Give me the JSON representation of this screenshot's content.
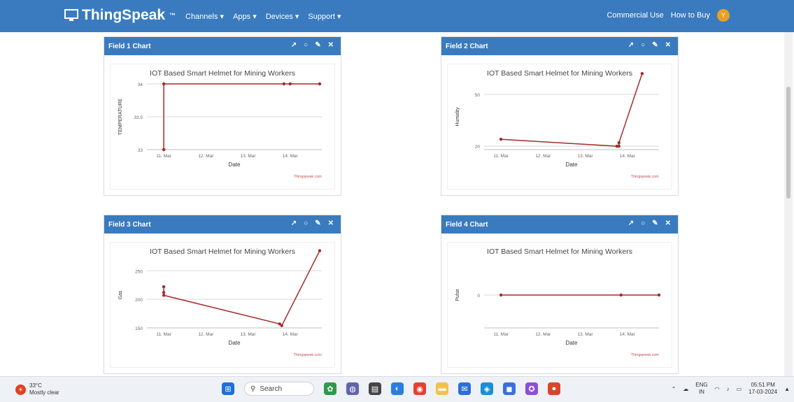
{
  "app": {
    "brand": "ThingSpeak",
    "brand_tm": "™",
    "nav": [
      "Channels ▾",
      "Apps ▾",
      "Devices ▾",
      "Support ▾"
    ],
    "right_nav": [
      "Commercial Use",
      "How to Buy"
    ],
    "avatar_initial": "Y"
  },
  "panels": [
    {
      "header": "Field 1 Chart"
    },
    {
      "header": "Field 2 Chart"
    },
    {
      "header": "Field 3 Chart"
    },
    {
      "header": "Field 4 Chart"
    }
  ],
  "panel_tools": [
    "↗",
    "○",
    "✎",
    "✕"
  ],
  "chart_data": [
    {
      "type": "line",
      "title": "IOT Based Smart Helmet for Mining Workers",
      "xlabel": "Date",
      "ylabel": "TEMPERATURE",
      "x_ticks": [
        "11. Mar",
        "12. Mar",
        "13. Mar",
        "14. Mar"
      ],
      "y_ticks": [
        "33",
        "33.5",
        "34"
      ],
      "ylim": [
        33,
        34
      ],
      "credit": "Thingspeak.com",
      "series": [
        {
          "x": [
            0.0,
            0.0,
            0.0,
            2.85,
            3.0,
            3.7
          ],
          "y": [
            33,
            33,
            34,
            34,
            34,
            34
          ]
        }
      ]
    },
    {
      "type": "line",
      "title": "IOT Based Smart Helmet for Mining Workers",
      "xlabel": "Date",
      "ylabel": "Humidity",
      "x_ticks": [
        "11. Mar",
        "12. Mar",
        "13. Mar",
        "14. Mar"
      ],
      "y_ticks": [
        "20",
        "50"
      ],
      "ylim": [
        18,
        56
      ],
      "credit": "Thingspeak.com",
      "series": [
        {
          "x": [
            0.0,
            2.75,
            2.8,
            2.8,
            3.35
          ],
          "y": [
            24,
            20,
            20,
            22,
            62
          ]
        }
      ]
    },
    {
      "type": "line",
      "title": "IOT Based Smart Helmet for Mining Workers",
      "xlabel": "Date",
      "ylabel": "Gas",
      "x_ticks": [
        "11. Mar",
        "12. Mar",
        "13. Mar",
        "14. Mar"
      ],
      "y_ticks": [
        "150",
        "200",
        "250"
      ],
      "ylim": [
        150,
        265
      ],
      "credit": "Thingspeak.com",
      "series": [
        {
          "x": [
            0.0,
            0.0,
            0.0,
            2.75,
            2.8,
            3.7
          ],
          "y": [
            222,
            212,
            207,
            157,
            154,
            285
          ]
        }
      ]
    },
    {
      "type": "line",
      "title": "IOT Based Smart Helmet for Mining Workers",
      "xlabel": "Date",
      "ylabel": "Pulse",
      "x_ticks": [
        "11. Mar",
        "12. Mar",
        "13. Mar",
        "14. Mar"
      ],
      "y_ticks": [
        "0"
      ],
      "ylim": [
        -1,
        1
      ],
      "credit": "Thingspeak.com",
      "series": [
        {
          "x": [
            0.0,
            2.85,
            3.75
          ],
          "y": [
            0,
            0,
            0
          ]
        }
      ]
    }
  ],
  "taskbar": {
    "temperature": "33°C",
    "weather": "Mostly clear",
    "search_placeholder": "Search",
    "lang": "ENG",
    "region": "IN",
    "time": "05:51 PM",
    "date": "17-03-2024"
  },
  "colors": {
    "header": "#3a7bbf",
    "line": "#a52a2a",
    "grid": "#d9d9d9"
  }
}
